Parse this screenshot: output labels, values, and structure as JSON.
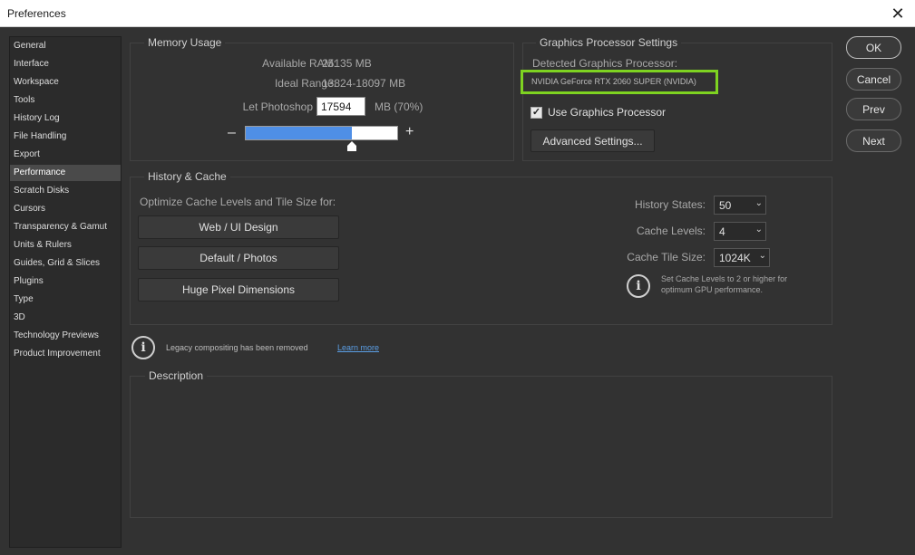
{
  "window": {
    "title": "Preferences"
  },
  "icons": {
    "close": "close-icon",
    "info": "info-icon",
    "check": "checkmark-icon",
    "chevron": "chevron-down-icon",
    "slider_thumb": "slider-thumb-icon"
  },
  "colors": {
    "accent": "#4f8fe6",
    "highlight_box": "#7ed321"
  },
  "sidebar": {
    "items": [
      {
        "label": "General"
      },
      {
        "label": "Interface"
      },
      {
        "label": "Workspace"
      },
      {
        "label": "Tools"
      },
      {
        "label": "History Log"
      },
      {
        "label": "File Handling"
      },
      {
        "label": "Export"
      },
      {
        "label": "Performance",
        "selected": true
      },
      {
        "label": "Scratch Disks"
      },
      {
        "label": "Cursors"
      },
      {
        "label": "Transparency & Gamut"
      },
      {
        "label": "Units & Rulers"
      },
      {
        "label": "Guides, Grid & Slices"
      },
      {
        "label": "Plugins"
      },
      {
        "label": "Type"
      },
      {
        "label": "3D"
      },
      {
        "label": "Technology Previews"
      },
      {
        "label": "Product Improvement"
      }
    ]
  },
  "memory": {
    "title": "Memory Usage",
    "available_label": "Available RAM:",
    "available_value": "25135 MB",
    "ideal_label": "Ideal Range:",
    "ideal_value": "13824-18097 MB",
    "use_label": "Let Photoshop Use:",
    "use_value": "17594",
    "use_suffix": "MB (70%)",
    "minus": "–",
    "plus": "+",
    "slider_fraction": 0.7
  },
  "gpu": {
    "title": "Graphics Processor Settings",
    "detected_label": "Detected Graphics Processor:",
    "detected_value": "NVIDIA GeForce RTX 2060 SUPER (NVIDIA)",
    "use_gpu_label": "Use Graphics Processor",
    "use_gpu_checked": true,
    "check_glyph": "✓",
    "advanced_button": "Advanced Settings..."
  },
  "history_cache": {
    "title": "History & Cache",
    "optimize_label": "Optimize Cache Levels and Tile Size for:",
    "buttons": [
      "Web / UI Design",
      "Default / Photos",
      "Huge Pixel Dimensions"
    ],
    "history_states_label": "History States:",
    "history_states_value": "50",
    "cache_levels_label": "Cache Levels:",
    "cache_levels_value": "4",
    "cache_tile_label": "Cache Tile Size:",
    "cache_tile_value": "1024K",
    "hint_line1": "Set Cache Levels to 2 or higher for",
    "hint_line2": "optimum GPU performance.",
    "chevron_glyph": "⌄"
  },
  "legacy": {
    "info_glyph": "i",
    "message": "Legacy compositing has been removed",
    "link": "Learn more"
  },
  "description": {
    "title": "Description",
    "text": ""
  },
  "actions": {
    "ok": "OK",
    "cancel": "Cancel",
    "prev": "Prev",
    "next": "Next"
  }
}
